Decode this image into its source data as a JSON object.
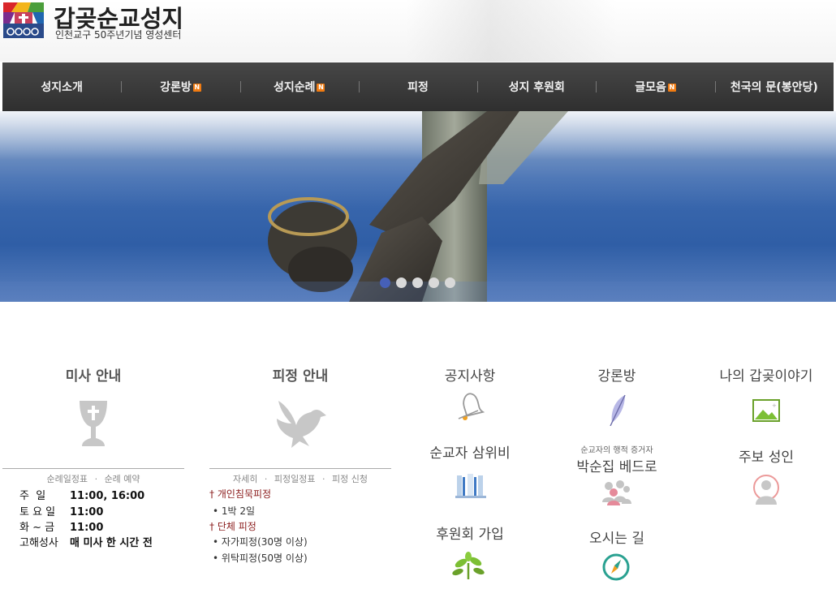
{
  "header": {
    "title": "갑곶순교성지",
    "subtitle": "인천교구 50주년기념 영성센터"
  },
  "nav": {
    "items": [
      {
        "label": "성지소개",
        "new": false
      },
      {
        "label": "강론방",
        "new": true
      },
      {
        "label": "성지순례",
        "new": true
      },
      {
        "label": "피정",
        "new": false
      },
      {
        "label": "성지 후원회",
        "new": false
      },
      {
        "label": "글모음",
        "new": true
      },
      {
        "label": "천국의 문(봉안당)",
        "new": false
      }
    ],
    "new_badge": "N"
  },
  "slider": {
    "dot_count": 5,
    "active_index": 0
  },
  "mass": {
    "title": "미사 안내",
    "links": [
      "순례일정표",
      "순례 예약"
    ],
    "separator": "·",
    "rows": [
      {
        "key": "주  일",
        "value": "11:00, 16:00"
      },
      {
        "key": "토 요 일",
        "value": "11:00"
      },
      {
        "key": "화 ~ 금",
        "value": "11:00"
      },
      {
        "key": "고해성사",
        "value": "매 미사 한 시간 전"
      }
    ]
  },
  "retreat": {
    "title": "피정 안내",
    "links": [
      "자세히",
      "피정일정표",
      "피정 신청"
    ],
    "separator": "·",
    "sections": [
      {
        "head": "개인침묵피정",
        "items": [
          "1박 2일"
        ]
      },
      {
        "head": "단체 피정",
        "items": [
          "자가피정(30명 이상)",
          "위탁피정(50명 이상)"
        ]
      }
    ]
  },
  "quick_links": {
    "notice": "공지사항",
    "homily": "강론방",
    "my_story": "나의 갑곶이야기",
    "martyr_monument": "순교자 삼위비",
    "witness_caption": "순교자의 행적 증거자",
    "witness_name": "박순집 베드로",
    "patron_saint": "주보 성인",
    "support_join": "후원회 가입",
    "directions": "오시는 길"
  },
  "colors": {
    "nav_bg": "#3a3a3a",
    "badge": "#f07b12",
    "retreat_head": "#8b1c1c",
    "active_dot": "#4660b8"
  }
}
